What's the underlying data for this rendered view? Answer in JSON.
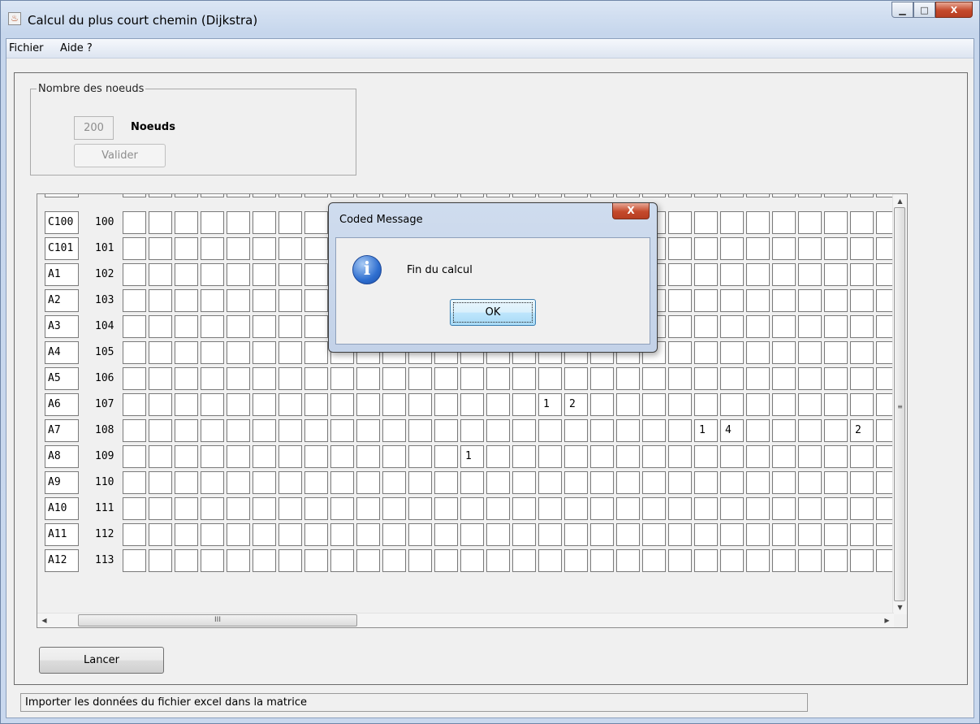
{
  "window": {
    "title": "Calcul du plus court chemin (Dijkstra)",
    "app_icon": "java-cup-icon",
    "controls": [
      "minimize",
      "maximize",
      "close"
    ],
    "close_label": "X"
  },
  "menu": {
    "items": [
      "Fichier",
      "Aide ?"
    ]
  },
  "nodes_group": {
    "legend": "Nombre des noeuds",
    "count_value": "200",
    "unit_label": "Noeuds",
    "validate_label": "Valider"
  },
  "grid": {
    "rows": [
      {
        "name": "C100",
        "index": "100",
        "cells": {}
      },
      {
        "name": "C101",
        "index": "101",
        "cells": {}
      },
      {
        "name": "A1",
        "index": "102",
        "cells": {}
      },
      {
        "name": "A2",
        "index": "103",
        "cells": {}
      },
      {
        "name": "A3",
        "index": "104",
        "cells": {}
      },
      {
        "name": "A4",
        "index": "105",
        "cells": {}
      },
      {
        "name": "A5",
        "index": "106",
        "cells": {}
      },
      {
        "name": "A6",
        "index": "107",
        "cells": {
          "16": "1",
          "17": "2"
        }
      },
      {
        "name": "A7",
        "index": "108",
        "cells": {
          "22": "1",
          "23": "4",
          "28": "2"
        }
      },
      {
        "name": "A8",
        "index": "109",
        "cells": {
          "13": "1"
        }
      },
      {
        "name": "A9",
        "index": "110",
        "cells": {}
      },
      {
        "name": "A10",
        "index": "111",
        "cells": {}
      },
      {
        "name": "A11",
        "index": "112",
        "cells": {}
      },
      {
        "name": "A12",
        "index": "113",
        "cells": {}
      }
    ],
    "scroll_grip": "≡",
    "hscroll_grip": "III"
  },
  "actions": {
    "run_label": "Lancer"
  },
  "status": {
    "text": "Importer les données du fichier excel dans la matrice"
  },
  "dialog": {
    "title": "Coded Message",
    "message": "Fin du calcul",
    "ok_label": "OK",
    "icon": "info-icon",
    "close_label": "X"
  }
}
